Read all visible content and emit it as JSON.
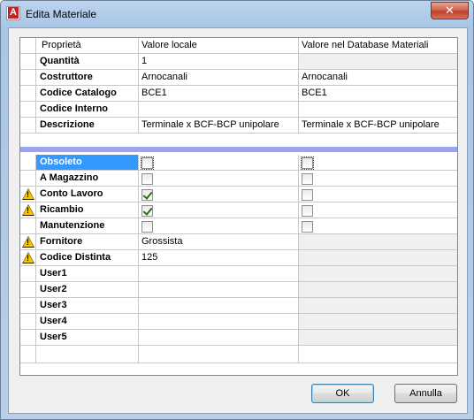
{
  "window": {
    "title": "Edita Materiale",
    "close_glyph": "✕",
    "app_icon_letter": "A"
  },
  "table": {
    "headers": [
      "Proprietà",
      "Valore locale",
      "Valore nel Database Materiali"
    ],
    "text_rows": [
      {
        "label": "Quantità",
        "local": "1",
        "db": "",
        "db_gray": true
      },
      {
        "label": "Costruttore",
        "local": "Arnocanali",
        "db": "Arnocanali",
        "db_gray": false
      },
      {
        "label": "Codice Catalogo",
        "local": "BCE1",
        "db": "BCE1",
        "db_gray": false
      },
      {
        "label": "Codice Interno",
        "local": "",
        "db": "",
        "db_gray": false
      },
      {
        "label": "Descrizione",
        "local": "Terminale x BCF-BCP unipolare",
        "db": "Terminale x BCF-BCP unipolare",
        "db_gray": false
      }
    ],
    "flag_rows": [
      {
        "label": "Obsoleto",
        "warning": false,
        "local_checked": false,
        "db_checked": false,
        "selected": true
      },
      {
        "label": "A Magazzino",
        "warning": false,
        "local_checked": false,
        "db_checked": false
      },
      {
        "label": "Conto Lavoro",
        "warning": true,
        "local_checked": true,
        "db_checked": false
      },
      {
        "label": "Ricambio",
        "warning": true,
        "local_checked": true,
        "db_checked": false
      },
      {
        "label": "Manutenzione",
        "warning": false,
        "local_checked": false,
        "db_checked": false
      }
    ],
    "extra_rows": [
      {
        "label": "Fornitore",
        "warning": true,
        "local": "Grossista",
        "db": ""
      },
      {
        "label": "Codice Distinta",
        "warning": true,
        "local": "125",
        "db": ""
      },
      {
        "label": "User1",
        "warning": false,
        "local": "",
        "db": ""
      },
      {
        "label": "User2",
        "warning": false,
        "local": "",
        "db": ""
      },
      {
        "label": "User3",
        "warning": false,
        "local": "",
        "db": ""
      },
      {
        "label": "User4",
        "warning": false,
        "local": "",
        "db": ""
      },
      {
        "label": "User5",
        "warning": false,
        "local": "",
        "db": ""
      }
    ]
  },
  "buttons": {
    "ok_label": "OK",
    "cancel_label": "Annulla"
  },
  "colors": {
    "selection": "#3399ff",
    "separator": "#9aa4f0",
    "warning": "#f5c400",
    "close": "#c0402a"
  }
}
